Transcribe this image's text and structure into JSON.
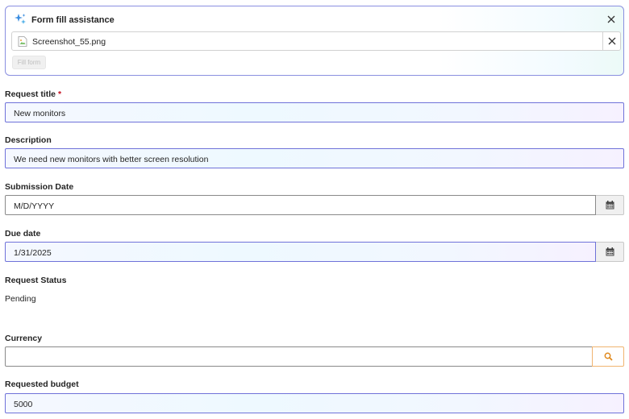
{
  "assistance": {
    "title": "Form fill assistance",
    "file_name": "Screenshot_55.png",
    "fill_button": "Fill form"
  },
  "fields": {
    "request_title": {
      "label": "Request title",
      "required_mark": "*",
      "value": "New monitors"
    },
    "description": {
      "label": "Description",
      "value": "We need new monitors with better screen resolution"
    },
    "submission_date": {
      "label": "Submission Date",
      "value": "M/D/YYYY"
    },
    "due_date": {
      "label": "Due date",
      "value": "1/31/2025"
    },
    "request_status": {
      "label": "Request Status",
      "value": "Pending"
    },
    "currency": {
      "label": "Currency",
      "value": ""
    },
    "requested_budget": {
      "label": "Requested budget",
      "value": "5000"
    }
  },
  "colors": {
    "accent_border": "#6f72d9",
    "required": "#c50f1f",
    "search_border": "#f0b470",
    "search_icon": "#e08a1e"
  }
}
